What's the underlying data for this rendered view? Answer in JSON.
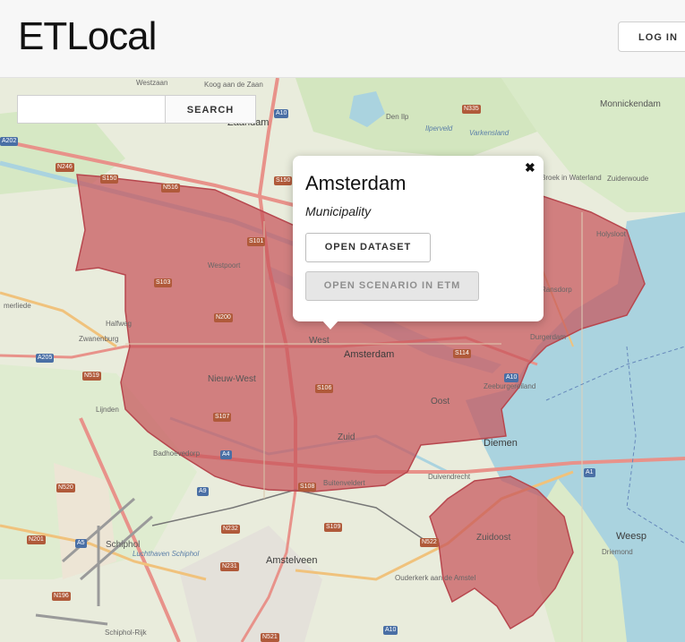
{
  "header": {
    "brand": "ETLocal",
    "login_label": "LOG IN"
  },
  "search": {
    "value": "",
    "placeholder": "",
    "button_label": "SEARCH"
  },
  "popup": {
    "title": "Amsterdam",
    "subtitle": "Municipality",
    "dataset_button": "OPEN DATASET",
    "etm_button": "OPEN SCENARIO IN ETM",
    "close_glyph": "✖"
  },
  "map": {
    "highlight_color": "#c8555b",
    "water_color": "#aad3df",
    "labels": {
      "westzaan": "Westzaan",
      "koog": "Koog aan de Zaan",
      "zaandam": "Zaandam",
      "den_ilp": "Den Ilp",
      "ilperveld": "Ilperveld",
      "varkensland": "Varkensland",
      "monnickendam": "Monnickendam",
      "broek": "Broek in Waterland",
      "zuiderwoude": "Zuiderwoude",
      "holysloot": "Holysloot",
      "westpoort": "Westpoort",
      "ransdorp": "Ransdorp",
      "durgerdam": "Durgerdam",
      "halfweg": "Halfweg",
      "zwanenburg": "Zwanenburg",
      "nieuw_west": "Nieuw-West",
      "west": "West",
      "amsterdam": "Amsterdam",
      "zeeburg": "Zeeburgereiland",
      "oost": "Oost",
      "zuid": "Zuid",
      "lijnden": "Lijnden",
      "badhoevedorp": "Badhoevedorp",
      "diemen": "Diemen",
      "duivendrecht": "Duivendrecht",
      "zuidoost": "Zuidoost",
      "schiphol": "Schiphol",
      "luchthaven": "Luchthaven Schiphol",
      "amstelveen": "Amstelveen",
      "ouderkerk": "Ouderkerk aan de Amstel",
      "weesp": "Weesp",
      "driemond": "Driemond",
      "schiphol_rijk": "Schiphol-Rijk",
      "buitenveldert": "Buitenveldert",
      "merliede": "merliede"
    },
    "roads": [
      "N246",
      "S150",
      "N516",
      "S150",
      "N335",
      "A10",
      "S103",
      "N200",
      "A205",
      "N519",
      "S106",
      "S107",
      "A4",
      "S114",
      "A10",
      "A9",
      "A1",
      "N520",
      "S108",
      "S109",
      "N232",
      "N201",
      "A5",
      "N231",
      "N522",
      "N196",
      "N521",
      "A10",
      "S101",
      "A202"
    ]
  }
}
